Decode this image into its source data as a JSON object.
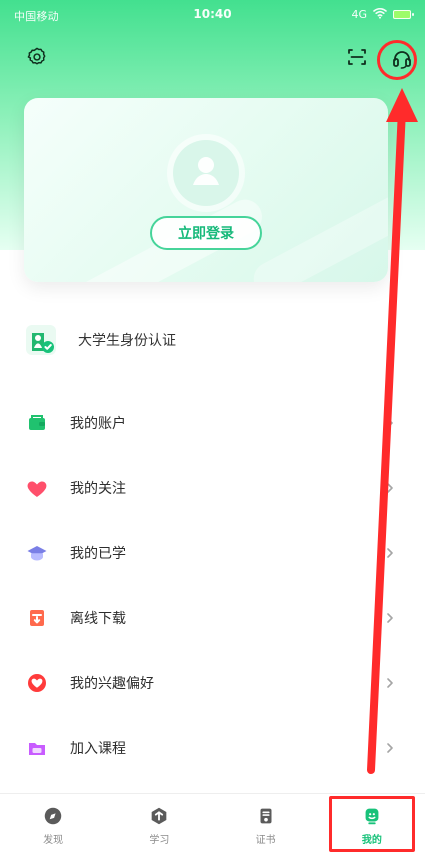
{
  "status_bar": {
    "carrier": "中国移动",
    "time": "10:40",
    "right_text": "4G"
  },
  "top_actions": {
    "settings_icon": "settings-icon",
    "scan_icon": "scan-icon",
    "support_icon": "headset-icon"
  },
  "login_card": {
    "login_label": "立即登录"
  },
  "verification": {
    "label": "大学生身份认证"
  },
  "menu": {
    "items": [
      {
        "label": "我的账户",
        "icon": "wallet-icon",
        "color": "#20c26f"
      },
      {
        "label": "我的关注",
        "icon": "heart-icon",
        "color": "#ff4f6b"
      },
      {
        "label": "我的已学",
        "icon": "graduation-cap-icon",
        "color": "#7a7fe6"
      },
      {
        "label": "离线下载",
        "icon": "download-box-icon",
        "color": "#ff6a4d"
      },
      {
        "label": "我的兴趣偏好",
        "icon": "interest-icon",
        "color": "#ff3b3b"
      },
      {
        "label": "加入课程",
        "icon": "folder-icon",
        "color": "#c85cff"
      }
    ]
  },
  "bottom_nav": {
    "items": [
      {
        "label": "发现",
        "icon": "compass-icon",
        "active": false
      },
      {
        "label": "学习",
        "icon": "learn-icon",
        "active": false
      },
      {
        "label": "证书",
        "icon": "certificate-icon",
        "active": false
      },
      {
        "label": "我的",
        "icon": "profile-icon",
        "active": true
      }
    ]
  },
  "colors": {
    "accent": "#18c27a",
    "annotation_red": "#ff2b2b"
  }
}
